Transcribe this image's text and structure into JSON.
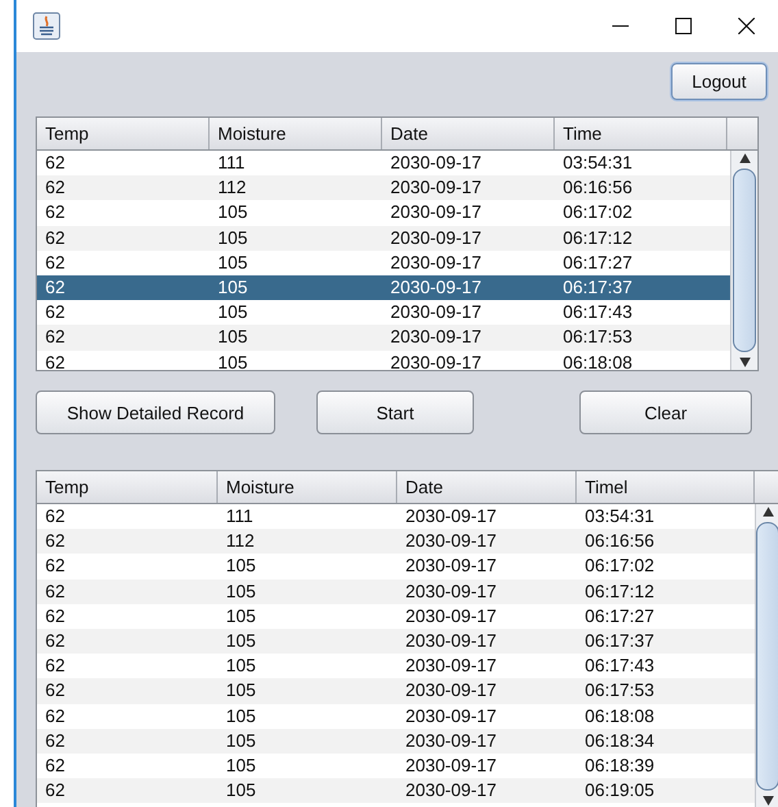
{
  "logout_button": "Logout",
  "top_table": {
    "columns": [
      "Temp",
      "Moisture",
      "Date",
      "Time"
    ],
    "rows": [
      {
        "cells": [
          "62",
          "111",
          "2030-09-17",
          "03:54:31"
        ],
        "selected": false
      },
      {
        "cells": [
          "62",
          "112",
          "2030-09-17",
          "06:16:56"
        ],
        "selected": false
      },
      {
        "cells": [
          "62",
          "105",
          "2030-09-17",
          "06:17:02"
        ],
        "selected": false
      },
      {
        "cells": [
          "62",
          "105",
          "2030-09-17",
          "06:17:12"
        ],
        "selected": false
      },
      {
        "cells": [
          "62",
          "105",
          "2030-09-17",
          "06:17:27"
        ],
        "selected": false
      },
      {
        "cells": [
          "62",
          "105",
          "2030-09-17",
          "06:17:37"
        ],
        "selected": true
      },
      {
        "cells": [
          "62",
          "105",
          "2030-09-17",
          "06:17:43"
        ],
        "selected": false
      },
      {
        "cells": [
          "62",
          "105",
          "2030-09-17",
          "06:17:53"
        ],
        "selected": false
      },
      {
        "cells": [
          "62",
          "105",
          "2030-09-17",
          "06:18:08"
        ],
        "selected": false
      }
    ]
  },
  "buttons": [
    "Show Detailed Record",
    "Start",
    "Clear"
  ],
  "bottom_table": {
    "columns": [
      "Temp",
      "Moisture",
      "Date",
      "Timel"
    ],
    "rows": [
      {
        "cells": [
          "62",
          "111",
          "2030-09-17",
          "03:54:31"
        ],
        "selected": false
      },
      {
        "cells": [
          "62",
          "112",
          "2030-09-17",
          "06:16:56"
        ],
        "selected": false
      },
      {
        "cells": [
          "62",
          "105",
          "2030-09-17",
          "06:17:02"
        ],
        "selected": false
      },
      {
        "cells": [
          "62",
          "105",
          "2030-09-17",
          "06:17:12"
        ],
        "selected": false
      },
      {
        "cells": [
          "62",
          "105",
          "2030-09-17",
          "06:17:27"
        ],
        "selected": false
      },
      {
        "cells": [
          "62",
          "105",
          "2030-09-17",
          "06:17:37"
        ],
        "selected": false
      },
      {
        "cells": [
          "62",
          "105",
          "2030-09-17",
          "06:17:43"
        ],
        "selected": false
      },
      {
        "cells": [
          "62",
          "105",
          "2030-09-17",
          "06:17:53"
        ],
        "selected": false
      },
      {
        "cells": [
          "62",
          "105",
          "2030-09-17",
          "06:18:08"
        ],
        "selected": false
      },
      {
        "cells": [
          "62",
          "105",
          "2030-09-17",
          "06:18:34"
        ],
        "selected": false
      },
      {
        "cells": [
          "62",
          "105",
          "2030-09-17",
          "06:18:39"
        ],
        "selected": false
      },
      {
        "cells": [
          "62",
          "105",
          "2030-09-17",
          "06:19:05"
        ],
        "selected": false
      }
    ]
  }
}
